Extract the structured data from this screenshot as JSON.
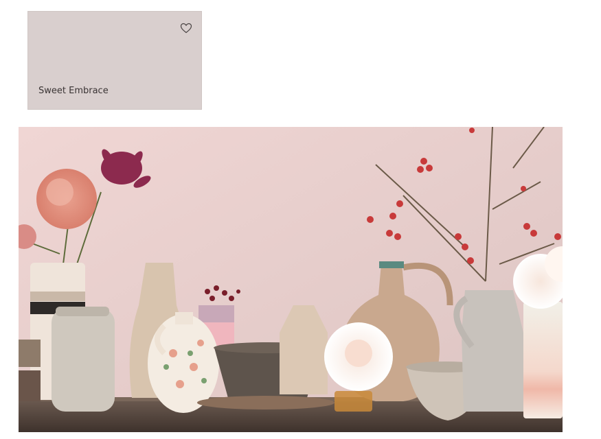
{
  "swatch": {
    "name": "Sweet Embrace",
    "color": "#d9cfce",
    "favorite_icon": "heart-outline-icon"
  },
  "photo": {
    "wall_color": "#e8d2d0",
    "table_color": "#5a4a40"
  }
}
